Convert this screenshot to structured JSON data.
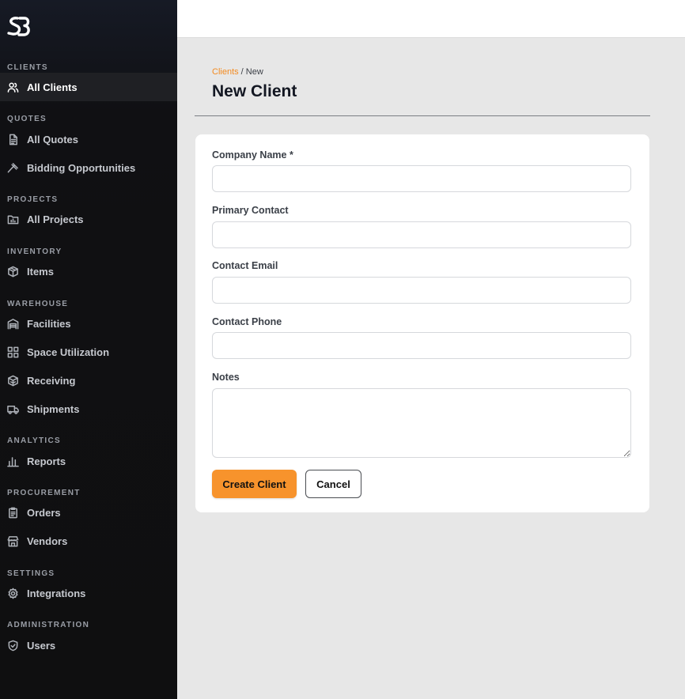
{
  "sidebar": {
    "logo_icon": "sb-logo-icon",
    "sections": {
      "clients": "CLIENTS",
      "quotes": "QUOTES",
      "projects": "PROJECTS",
      "inventory": "INVENTORY",
      "warehouse": "WAREHOUSE",
      "analytics": "ANALYTICS",
      "procurement": "PROCUREMENT",
      "settings": "SETTINGS",
      "administration": "ADMINISTRATION"
    },
    "items": {
      "all_clients": "All Clients",
      "all_quotes": "All Quotes",
      "bidding": "Bidding Opportunities",
      "all_projects": "All Projects",
      "items": "Items",
      "facilities": "Facilities",
      "space": "Space Utilization",
      "receiving": "Receiving",
      "shipments": "Shipments",
      "reports": "Reports",
      "orders": "Orders",
      "vendors": "Vendors",
      "integrations": "Integrations",
      "users": "Users"
    },
    "active_item": "All Clients"
  },
  "breadcrumb": {
    "parent": "Clients",
    "separator": " / ",
    "current": "New"
  },
  "page": {
    "title": "New Client"
  },
  "form": {
    "company_name_label": "Company Name *",
    "company_name_value": "",
    "primary_contact_label": "Primary Contact",
    "primary_contact_value": "",
    "contact_email_label": "Contact Email",
    "contact_email_value": "",
    "contact_phone_label": "Contact Phone",
    "contact_phone_value": "",
    "notes_label": "Notes",
    "notes_value": "",
    "submit_label": "Create Client",
    "cancel_label": "Cancel"
  },
  "colors": {
    "accent": "#f7932c",
    "breadcrumb_link": "#f38a1f",
    "sidebar_bg": "#0f0f10",
    "main_bg": "#e7e7e7"
  }
}
